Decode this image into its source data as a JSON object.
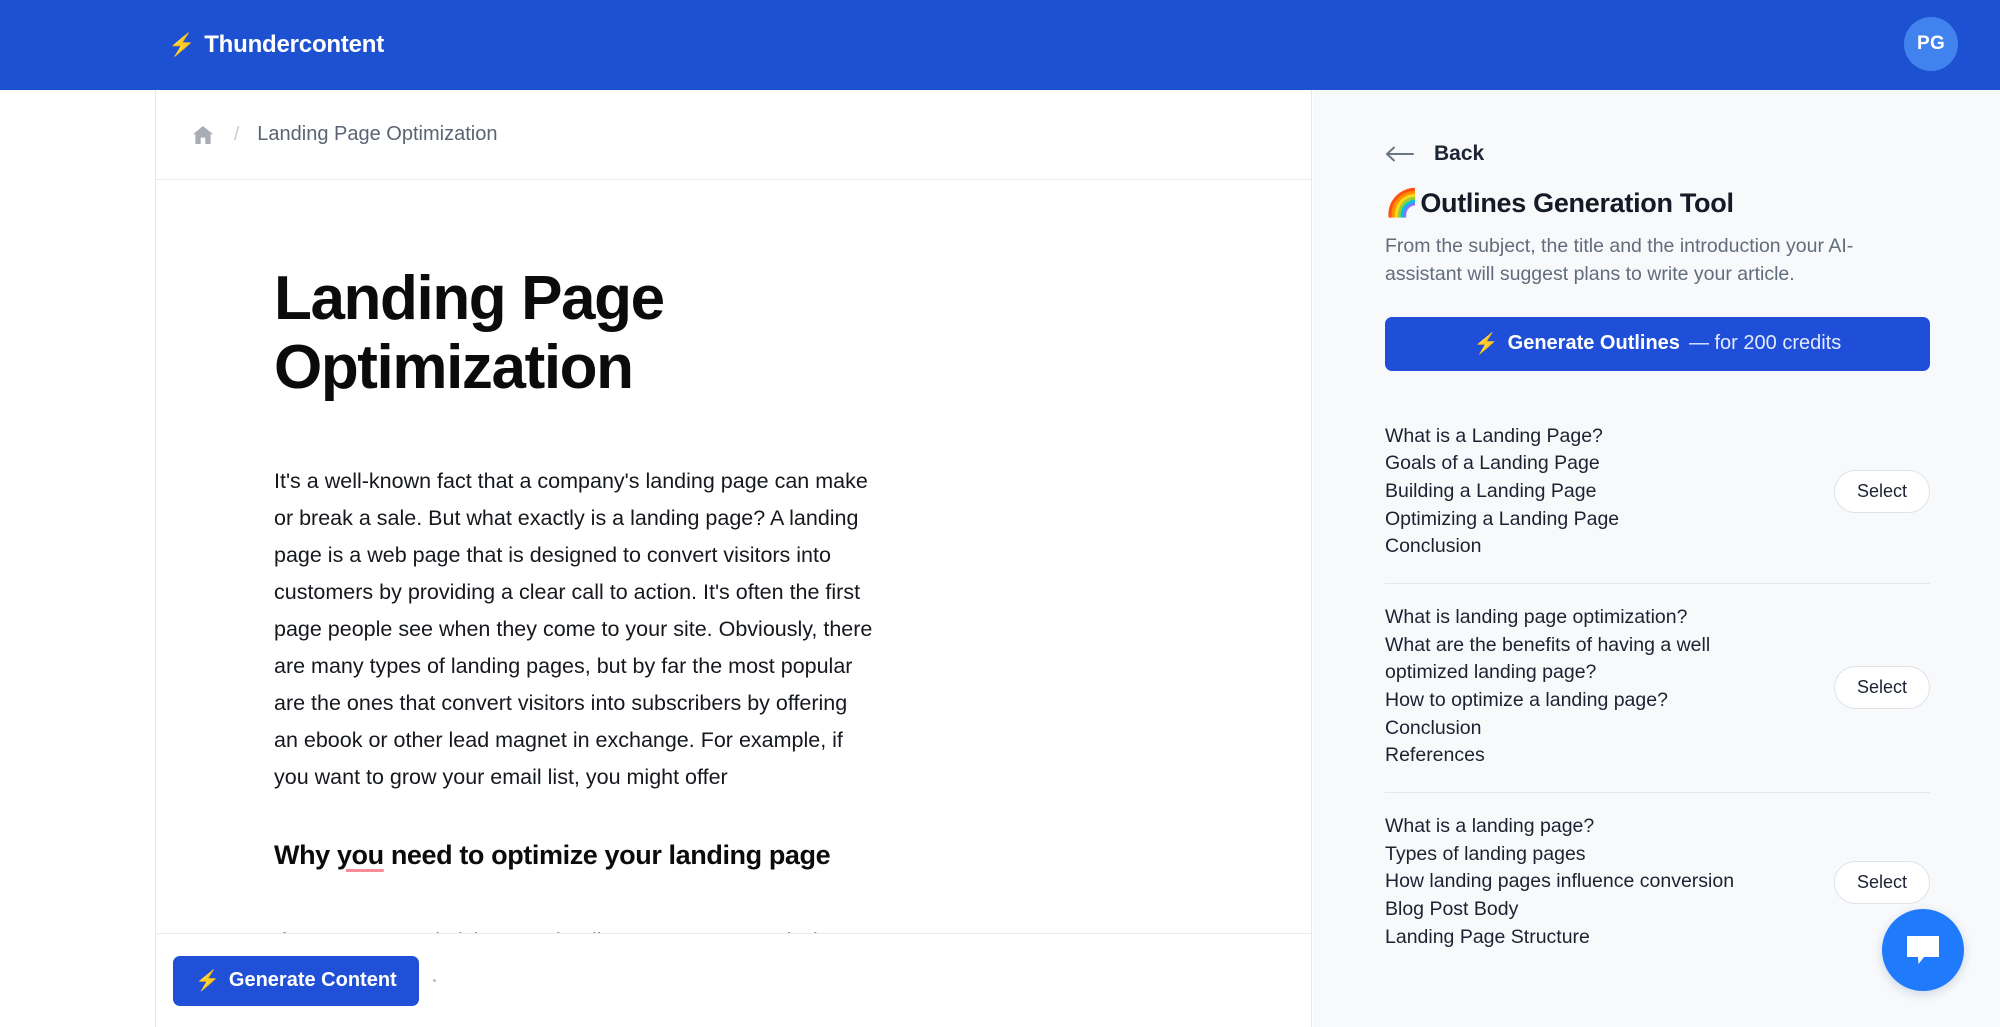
{
  "topbar": {
    "brand_icon": "lightning-bolt-icon",
    "brand_name": "Thundercontent",
    "avatar_initials": "PG"
  },
  "breadcrumb": {
    "home_icon": "home-icon",
    "separator": "/",
    "current": "Landing Page Optimization"
  },
  "document": {
    "title": "Landing Page Optimization",
    "paragraph_1_pre": "It's a well-known fact that a company's landing page can make or break a sale. But what exactly is a landing page?  A landing page is a web page that is designed to convert visitors into customers by providing a clear call to action. It's often the first page people see when they come to your site. Obviously, there are many types of landing pages, but by far the most popular are the ones that convert visitors into subscribers by offering an ebook or other lead magnet in exchange. For example, if you want to grow your email list, you might offer",
    "heading_2_before": "Why ",
    "heading_2_misspelled": "you",
    "heading_2_after": " need to optimize your landing page",
    "paragraph_2": "If you are not optimizing your landing page, you are missing out on a lot of potential customers. If you are not getting enough visitors to your site, you"
  },
  "bottombar": {
    "generate_content_icon": "lightning-bolt-icon",
    "generate_content_label": "Generate Content"
  },
  "panel": {
    "back_icon": "arrow-left-icon",
    "back_label": "Back",
    "title_emoji": "🌈",
    "title": "Outlines Generation Tool",
    "description": "From the subject, the title and the introduction your AI-assistant will suggest plans to write your article.",
    "generate_button": {
      "icon": "lightning-bolt-icon",
      "label_strong": "Generate Outlines",
      "label_light": "— for 200 credits"
    },
    "select_label": "Select",
    "outlines": [
      {
        "items": [
          "What is a Landing Page?",
          "Goals of a Landing Page",
          "Building a Landing Page",
          "Optimizing a Landing Page",
          "Conclusion"
        ]
      },
      {
        "items": [
          "What is landing page optimization?",
          "What are the benefits of having a well optimized landing page?",
          "How to optimize a landing page?",
          "Conclusion",
          "References"
        ]
      },
      {
        "items": [
          "What is a landing page?",
          "Types of landing pages",
          "How landing pages influence conversion",
          "Blog Post Body",
          "Landing Page Structure"
        ]
      }
    ]
  },
  "chat_widget": {
    "icon": "chat-bubble-icon"
  },
  "colors": {
    "brand_blue": "#1e50d2",
    "button_blue": "#1f4ed8",
    "panel_bg": "#f7f9fb",
    "chat_blue": "#1f7bfb",
    "spellcheck_underline": "#f98c9a"
  }
}
